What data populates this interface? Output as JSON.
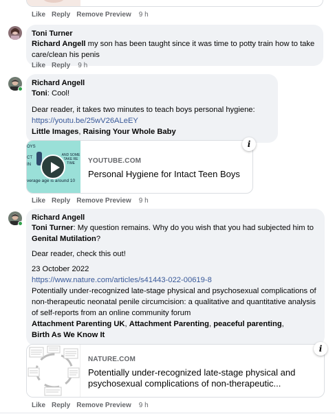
{
  "top": {
    "actions": {
      "like": "Like",
      "reply": "Reply",
      "remove_preview": "Remove Preview",
      "time": "9 h"
    }
  },
  "comment1": {
    "author": "Toni Turner",
    "mention": "Richard Angell",
    "text": " my son has been taught since it was time to potty train how to take care/clean his penis",
    "actions": {
      "like": "Like",
      "reply": "Reply",
      "time": "9 h"
    }
  },
  "comment2": {
    "author": "Richard Angell",
    "mention": "Toni",
    "line1_rest": ": Cool!",
    "line2": "Dear reader, it takes two minutes to teach boys personal hygiene:",
    "url": "https://youtu.be/25wV26ALeEY",
    "tag1": "Little Images",
    "sep": ", ",
    "tag2": "Raising Your Whole Baby",
    "card": {
      "domain": "YOUTUBE.COM",
      "title": "Personal Hygiene for Intact Teen Boys",
      "thumb_text_left": "OYS",
      "thumb_text_left2": "CT",
      "thumb_text_left3": "IN",
      "thumb_text_right": "AND SOME TAKE RE TIME",
      "thumb_caption": "verage age is around 10"
    },
    "actions": {
      "like": "Like",
      "reply": "Reply",
      "remove_preview": "Remove Preview",
      "time": "9 h"
    }
  },
  "comment3": {
    "author": "Richard Angell",
    "mention": "Toni Turner",
    "q_text": ": My question remains. Why do you wish that you had subjected him to ",
    "q_bold": "Genital Mutilation",
    "q_end": "?",
    "check": "Dear reader, check this out!",
    "date": "23 October 2022",
    "url": "https://www.nature.com/articles/s41443-022-00619-8",
    "desc": "Potentially under-recognized late-stage physical and psychosexual complications of non-therapeutic neonatal penile circumcision: a qualitative and quantitative analysis of self-reports from an online community forum",
    "tag1": "Attachment Parenting UK",
    "tag2": "Attachment Parenting",
    "tag3": "peaceful parenting",
    "tag4": "Birth As We Know It",
    "sep": ", ",
    "card": {
      "domain": "NATURE.COM",
      "title": "Potentially under-recognized late-stage physical and psychosexual complications of non-therapeutic..."
    },
    "actions": {
      "like": "Like",
      "reply": "Reply",
      "remove_preview": "Remove Preview",
      "time": "9 h"
    }
  },
  "info_icon": "i",
  "colors": {
    "link": "#385898",
    "bubble": "#f0f2f5",
    "meta": "#65676b",
    "online": "#31a24c"
  }
}
